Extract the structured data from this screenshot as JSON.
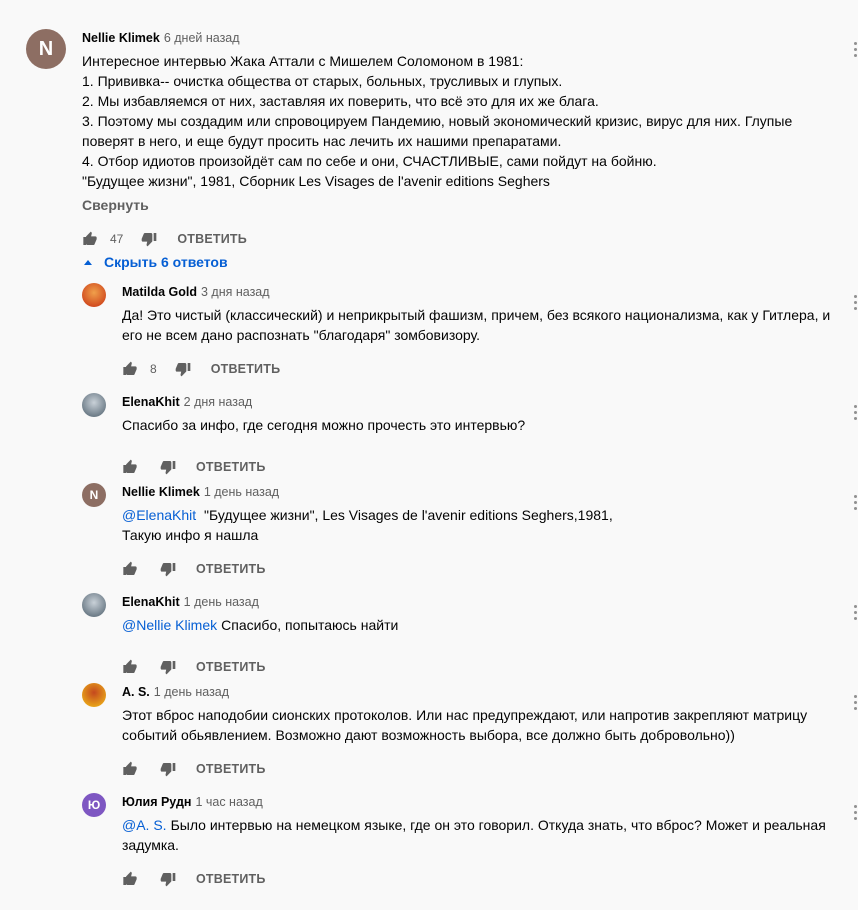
{
  "top_comment": {
    "avatar_letter": "N",
    "avatar_color": "#8d6e63",
    "author": "Nellie Klimek",
    "time": "6 дней назад",
    "lines": [
      "Интересное интервью Жака Аттали с Мишелем Соломоном в 1981:",
      "1. Прививка-- очистка общества от старых, больных, трусливых и глупых.",
      "2. Мы избавляемся от них, заставляя их поверить, что всё это для их же блага.",
      "3. Поэтому мы создадим или спровоцируем Пандемию, новый экономический кризис, вирус для них. Глупые поверят в него, и еще будут просить нас лечить их нашими препаратами.",
      "4. Отбор идиотов произойдёт сам по себе и  они, СЧАСТЛИВЫЕ, сами пойдут на бойню.",
      "\"Будущее жизни\", 1981, Сборник Les Visages de l'avenir editions Seghers"
    ],
    "collapse_label": "Свернуть",
    "like_count": "47",
    "reply_label": "ОТВЕТИТЬ",
    "like_icon": "thumb-up-icon",
    "dislike_icon": "thumb-down-icon"
  },
  "toggle_replies_label": "Скрыть 6 ответов",
  "replies": [
    {
      "author": "Matilda Gold",
      "time": "3 дня назад",
      "avatar_type": "image",
      "avatar_colors": [
        "#d14b1f",
        "#f0a04b"
      ],
      "mention": "",
      "text": "Да! Это чистый (классический) и неприкрытый фашизм, причем, без всякого национализма, как у Гитлера, и его не всем дано распознать \"благодаря\" зомбовизору.",
      "like_count": "8",
      "reply_label": "ОТВЕТИТЬ"
    },
    {
      "author": "ElenaKhit",
      "time": "2 дня назад",
      "avatar_type": "image",
      "avatar_colors": [
        "#6b7a86",
        "#c9d1d8"
      ],
      "mention": "",
      "text": "Спасибо за инфо, где сегодня  можно прочесть это интервью?",
      "like_count": "",
      "reply_label": "ОТВЕТИТЬ"
    },
    {
      "author": "Nellie Klimek",
      "time": "1 день назад",
      "avatar_type": "letter",
      "avatar_letter": "N",
      "avatar_colors": [
        "#8d6e63",
        "#8d6e63"
      ],
      "mention": "@ElenaKhit",
      "text": " \"Будущее жизни\", Les Visages de l'avenir editions Seghers,1981,\nТакую инфо я нашла",
      "like_count": "",
      "reply_label": "ОТВЕТИТЬ"
    },
    {
      "author": "ElenaKhit",
      "time": "1 день назад",
      "avatar_type": "image",
      "avatar_colors": [
        "#6b7a86",
        "#c9d1d8"
      ],
      "mention": "@Nellie Klimek",
      "text": "Спасибо, попытаюсь найти",
      "like_count": "",
      "reply_label": "ОТВЕТИТЬ"
    },
    {
      "author": "A. S.",
      "time": "1 день назад",
      "avatar_type": "image",
      "avatar_colors": [
        "#e8a31a",
        "#c4481e"
      ],
      "mention": "",
      "text": "Этот вброс наподобии сионских протоколов. Или нас предупреждают, или напротив закрепляют матрицу событий обьявлением. Возможно дают возможность выбора, все должно быть добровольно))",
      "like_count": "",
      "reply_label": "ОТВЕТИТЬ"
    },
    {
      "author": "Юлия Рудн",
      "time": "1 час назад",
      "avatar_type": "letter",
      "avatar_letter": "Ю",
      "avatar_colors": [
        "#7e57c2",
        "#7e57c2"
      ],
      "mention": "@A. S.",
      "text": "Было интервью на немецком языке, где он это говорил. Откуда знать, что вброс? Может и реальная задумка.",
      "like_count": "",
      "reply_label": "ОТВЕТИТЬ"
    }
  ]
}
